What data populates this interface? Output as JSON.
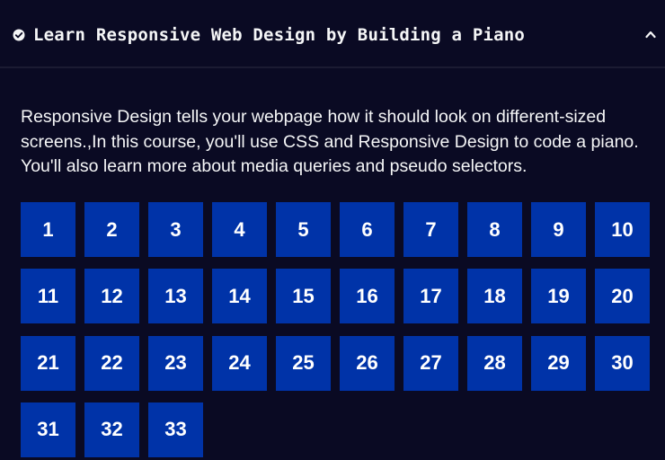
{
  "header": {
    "title": "Learn Responsive Web Design by Building a Piano",
    "status_icon": "check-circle-icon",
    "toggle_icon": "chevron-up-icon"
  },
  "description": {
    "lines": [
      "Responsive Design tells your webpage how it should look on different-sized",
      "screens.,In this course, you'll use CSS and Responsive Design to code a piano.",
      "You'll also learn more about media queries and pseudo selectors."
    ]
  },
  "steps": [
    "1",
    "2",
    "3",
    "4",
    "5",
    "6",
    "7",
    "8",
    "9",
    "10",
    "11",
    "12",
    "13",
    "14",
    "15",
    "16",
    "17",
    "18",
    "19",
    "20",
    "21",
    "22",
    "23",
    "24",
    "25",
    "26",
    "27",
    "28",
    "29",
    "30",
    "31",
    "32",
    "33"
  ],
  "colors": {
    "background": "#0a0a23",
    "step_background": "#0033a8",
    "text": "#f5f6f7"
  }
}
